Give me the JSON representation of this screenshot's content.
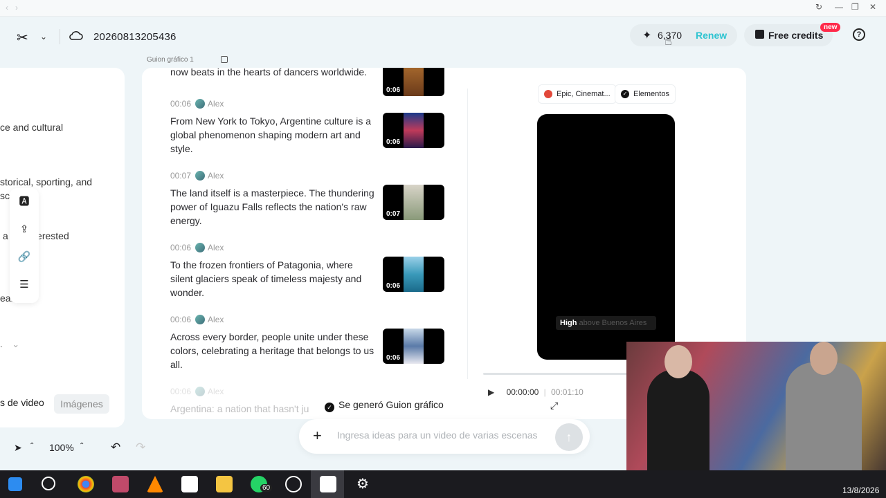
{
  "header": {
    "project_title": "20260813205436",
    "credits": "6,370",
    "renew_label": "Renew",
    "free_credits_label": "Free credits",
    "new_badge": "new",
    "help": "?"
  },
  "left_panel": {
    "lines": [
      "ce and cultural",
      "storical, sporting, and",
      "sc",
      "a     ple interested",
      "eal"
    ],
    "tabs": [
      "s de video",
      "Imágenes"
    ],
    "select_value": "."
  },
  "bottom_tools": {
    "zoom": "100%"
  },
  "storyboard": {
    "label": "Guion gráfico 1",
    "top_partial_text": "now beats in the hearts of dancers worldwide.",
    "top_partial_dur": "0:06",
    "scenes": [
      {
        "time": "00:06",
        "speaker": "Alex",
        "text": "From New York to Tokyo, Argentine culture is a global phenomenon shaping modern art and style.",
        "dur": "0:06"
      },
      {
        "time": "00:07",
        "speaker": "Alex",
        "text": "The land itself is a masterpiece. The thundering power of Iguazu Falls reflects the nation's raw energy.",
        "dur": "0:07"
      },
      {
        "time": "00:06",
        "speaker": "Alex",
        "text": "To the frozen frontiers of Patagonia, where silent glaciers speak of timeless majesty and wonder.",
        "dur": "0:06"
      },
      {
        "time": "00:06",
        "speaker": "Alex",
        "text": "Across every border, people unite under these colors, celebrating a heritage that belongs to us all.",
        "dur": "0:06"
      }
    ],
    "faded_scene": {
      "time": "00:06",
      "speaker": "Alex",
      "text": "Argentina: a nation that hasn't ju"
    }
  },
  "preview": {
    "style_pill": "Epic, Cinemat...",
    "elements_pill": "Elementos",
    "caption_bold": "High",
    "caption_rest": " above Buenos Aires",
    "current_time": "00:00:00",
    "total_time": "00:01:10"
  },
  "status": {
    "message": "Se generó Guion gráfico"
  },
  "prompt": {
    "placeholder": "Ingresa ideas para un video de varias escenas"
  },
  "taskbar": {
    "whatsapp_badge": "60",
    "date": "13/8/2026"
  }
}
